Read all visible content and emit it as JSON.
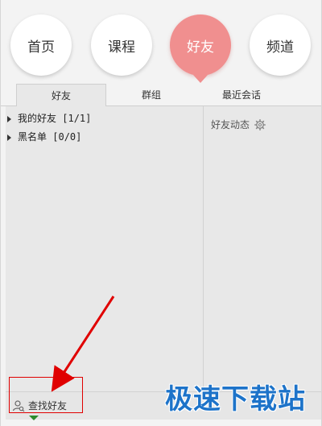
{
  "nav": {
    "items": [
      {
        "label": "首页",
        "active": false
      },
      {
        "label": "课程",
        "active": false
      },
      {
        "label": "好友",
        "active": true
      },
      {
        "label": "频道",
        "active": false
      }
    ],
    "active_color": "#f08f8f"
  },
  "tabs": [
    {
      "label": "好友",
      "active": true
    },
    {
      "label": "群组",
      "active": false
    },
    {
      "label": "最近会话",
      "active": false
    }
  ],
  "friend_groups": [
    {
      "name": "我的好友",
      "count": "[1/1]"
    },
    {
      "name": "黑名单",
      "count": "[0/0]"
    }
  ],
  "feed": {
    "title": "好友动态",
    "settings_icon": "gear-icon"
  },
  "bottom": {
    "find_friends_label": "查找好友",
    "find_icon": "user-search-icon"
  },
  "annotation": {
    "color": "#e00000"
  },
  "watermark": {
    "text": "极速下载站",
    "color": "#1d73c9"
  }
}
